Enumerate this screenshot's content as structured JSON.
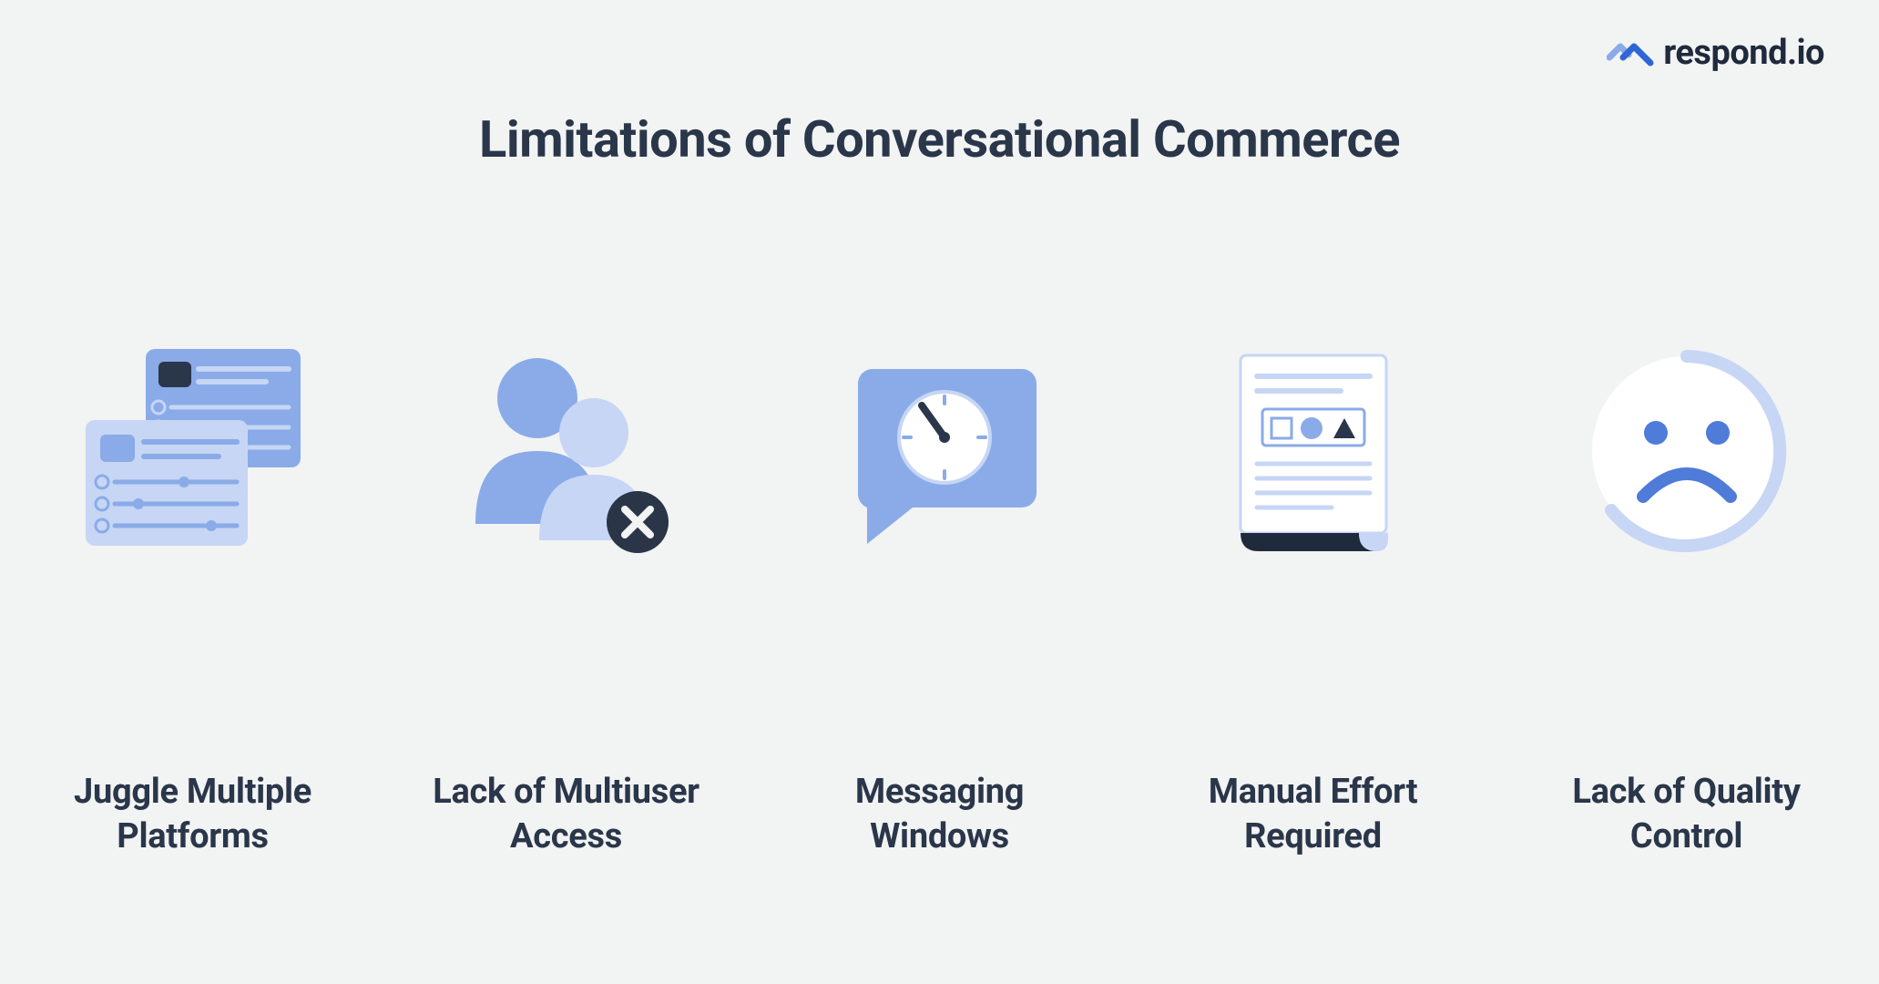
{
  "brand": {
    "name": "respond.io"
  },
  "title": "Limitations of Conversational Commerce",
  "items": [
    {
      "label": "Juggle Multiple\nPlatforms",
      "icon": "platforms-icon"
    },
    {
      "label": "Lack of Multiuser\nAccess",
      "icon": "multiuser-icon"
    },
    {
      "label": "Messaging\nWindows",
      "icon": "messaging-window-icon"
    },
    {
      "label": "Manual Effort\nRequired",
      "icon": "document-icon"
    },
    {
      "label": "Lack of Quality\nControl",
      "icon": "sad-face-icon"
    }
  ],
  "colors": {
    "bg": "#f2f3f3",
    "text": "#2a3649",
    "blue_light": "#c6d6f4",
    "blue_mid": "#8aabe8",
    "blue_dark": "#2f66d6",
    "navy": "#1f2a3c",
    "white": "#ffffff"
  }
}
